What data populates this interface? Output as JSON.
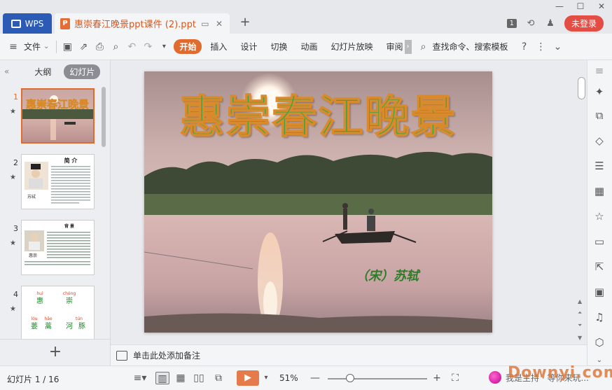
{
  "app": {
    "wps_tab_label": "WPS",
    "doc_tab_title": "惠崇春江晚景ppt课件 (2).ppt",
    "new_tab_symbol": "+",
    "badge_count": "1",
    "login_label": "未登录"
  },
  "toolbar": {
    "file_label": "文件",
    "tabs": [
      "开始",
      "插入",
      "设计",
      "切换",
      "动画",
      "幻灯片放映",
      "审阅"
    ],
    "search_label": "查找命令、搜索模板",
    "help_symbol": "?",
    "more_symbol": "⋮"
  },
  "left_panel": {
    "tab_outline": "大纲",
    "tab_slides": "幻灯片",
    "thumbnails": [
      {
        "num": "1",
        "title": "惠崇春江晚景"
      },
      {
        "num": "2",
        "title": "简 介",
        "caption": "苏轼"
      },
      {
        "num": "3",
        "title": "背 景",
        "caption": "惠崇"
      },
      {
        "num": "4",
        "pinyin": [
          "huì",
          "chóng",
          "lóu",
          "hāo",
          "tún"
        ],
        "chars": [
          "惠",
          "崇",
          "蒌",
          "蒿",
          "河",
          "豚"
        ]
      }
    ],
    "add_symbol": "+"
  },
  "slide": {
    "title": "惠崇春江晚景",
    "author": "（宋）苏轼"
  },
  "notes": {
    "placeholder": "单击此处添加备注"
  },
  "status": {
    "slide_indicator": "幻灯片 1 / 16",
    "zoom": "51%",
    "promo_text": "我是主持 · 等你来玩..."
  },
  "watermark": "Downyi.com",
  "colors": {
    "accent": "#e06b2e",
    "wps_blue": "#2b5bb5",
    "title_green": "#3aa545",
    "login_red": "#e34d43"
  }
}
